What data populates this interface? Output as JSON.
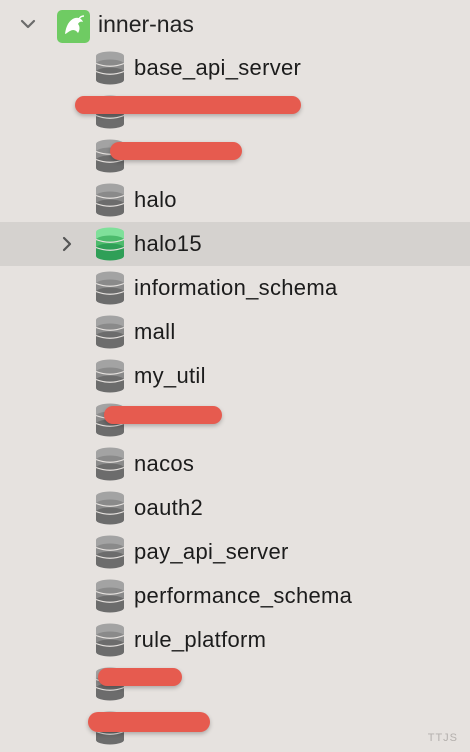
{
  "connection": {
    "name": "inner-nas",
    "icon": "mysql-dolphin-icon",
    "expanded": true,
    "accent": "#6fcb63"
  },
  "databases": [
    {
      "name": "base_api_server",
      "redacted": false,
      "active": false
    },
    {
      "name": "",
      "redacted": true,
      "active": false
    },
    {
      "name": "",
      "redacted": true,
      "active": false
    },
    {
      "name": "halo",
      "redacted": false,
      "active": false
    },
    {
      "name": "halo15",
      "redacted": false,
      "active": true,
      "collapsed": true
    },
    {
      "name": "information_schema",
      "redacted": false,
      "active": false
    },
    {
      "name": "mall",
      "redacted": false,
      "active": false
    },
    {
      "name": "my_util",
      "redacted": false,
      "active": false
    },
    {
      "name": "",
      "redacted": true,
      "active": false
    },
    {
      "name": "nacos",
      "redacted": false,
      "active": false
    },
    {
      "name": "oauth2",
      "redacted": false,
      "active": false
    },
    {
      "name": "pay_api_server",
      "redacted": false,
      "active": false
    },
    {
      "name": "performance_schema",
      "redacted": false,
      "active": false
    },
    {
      "name": "rule_platform",
      "redacted": false,
      "active": false
    },
    {
      "name": "",
      "redacted": true,
      "active": false
    },
    {
      "name": "",
      "redacted": true,
      "active": false
    }
  ],
  "watermark": "TTJS",
  "colors": {
    "background": "#e6e2df",
    "selected_row": "#d5d2cf",
    "db_icon_gray": "#8a8a8a",
    "db_icon_active": "#4cbb6c",
    "redaction": "#e65b4f"
  }
}
